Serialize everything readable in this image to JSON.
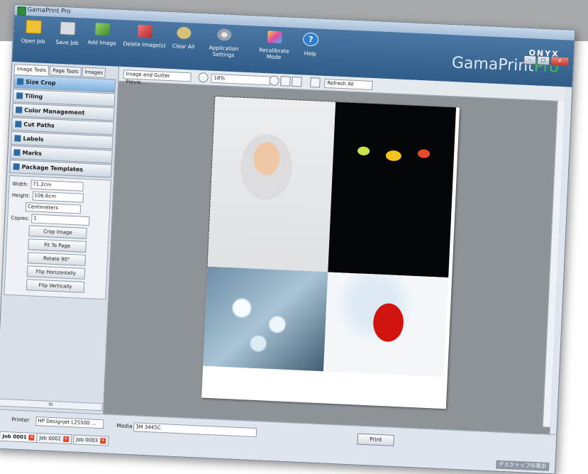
{
  "window": {
    "title": "GamaPrint Pro",
    "controls": [
      "–",
      "□",
      "✕"
    ]
  },
  "toolbar": [
    {
      "label": "Open Job",
      "icon": "folder-icon"
    },
    {
      "label": "Save Job",
      "icon": "save-icon"
    },
    {
      "label": "Add Image",
      "icon": "add-image-icon"
    },
    {
      "label": "Delete Image(s)",
      "icon": "delete-image-icon"
    },
    {
      "label": "Clear All",
      "icon": "clear-all-icon"
    },
    {
      "label": "Application Settings",
      "icon": "gear-icon"
    },
    {
      "label": "Recalibrate Mode",
      "icon": "recalibrate-icon"
    },
    {
      "label": "Help",
      "icon": "help-icon",
      "glyph": "?"
    }
  ],
  "brand": {
    "company": "ONYX",
    "product": "GamaPrint",
    "edition": "Pro"
  },
  "panel_tabs": [
    "Image Tools",
    "Page Tools",
    "Images"
  ],
  "sections": [
    "Size Crop",
    "Tiling",
    "Color Management",
    "Cut Paths",
    "Labels",
    "Marks",
    "Package Templates"
  ],
  "size": {
    "width_label": "Width:",
    "width_value": "71.2cm",
    "height_label": "Height:",
    "height_value": "106.6cm",
    "units": "Centimeters",
    "copies_label": "Copies:",
    "copies_value": "1"
  },
  "buttons": [
    "Crop Image",
    "Fit To Page",
    "Rotate 90°",
    "Flip Horizontally",
    "Flip Vertically"
  ],
  "left_scroll_label": "III",
  "view": {
    "mode": "Image and Gutter Previe...",
    "zoom": "18%",
    "refresh": "Refresh All"
  },
  "status": {
    "printer_label": "Printer",
    "printer_value": "HP Designjet L25500 ...",
    "media_label": "Media",
    "media_value": "3M 3445C",
    "print_button": "Print",
    "desktop": "デスクトップの表示"
  },
  "jobs": [
    "Job 0001",
    "Job 0002",
    "Job 0003"
  ],
  "job_close_glyph": "✕",
  "colors": {
    "ribbon": "#3a6693",
    "accent_green": "#3fbf48",
    "canvas": "#8e9398"
  }
}
